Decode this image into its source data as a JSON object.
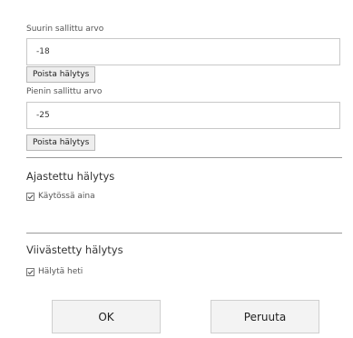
{
  "max_value": {
    "label": "Suurin sallittu arvo",
    "value": "-18",
    "remove_label": "Poista hälytys"
  },
  "min_value": {
    "label": "Pienin sallittu arvo",
    "value": "-25",
    "remove_label": "Poista hälytys"
  },
  "scheduled_alarm": {
    "title": "Ajastettu hälytys",
    "option_label": "Käytössä aina",
    "checked": true
  },
  "delayed_alarm": {
    "title": "Viivästetty hälytys",
    "option_label": "Hälytä heti",
    "checked": true
  },
  "buttons": {
    "ok_label": "OK",
    "cancel_label": "Peruuta"
  }
}
